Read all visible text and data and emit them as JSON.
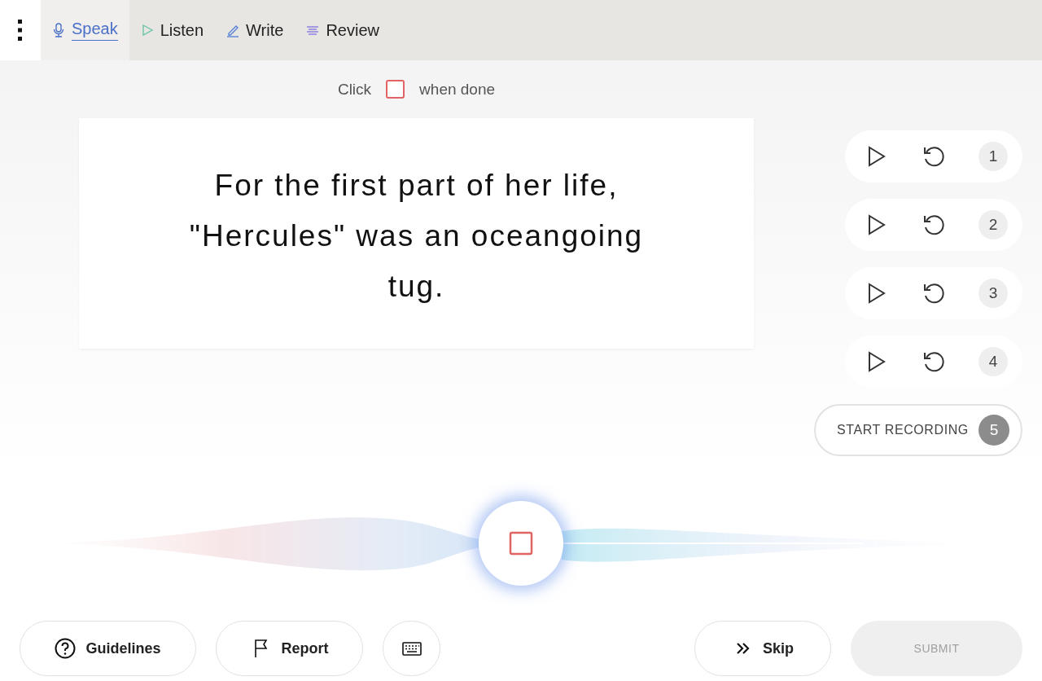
{
  "tabs": [
    {
      "kind": "speak",
      "label": "Speak",
      "selected": true
    },
    {
      "kind": "listen",
      "label": "Listen",
      "selected": false
    },
    {
      "kind": "write",
      "label": "Write",
      "selected": false
    },
    {
      "kind": "review",
      "label": "Review",
      "selected": false
    }
  ],
  "done_hint": {
    "before": "Click",
    "after": "when done",
    "checked": false
  },
  "sentence": "For the first part of her life, \"Hercules\" was an oceangoing tug.",
  "clips": [
    {
      "number": "1"
    },
    {
      "number": "2"
    },
    {
      "number": "3"
    },
    {
      "number": "4"
    }
  ],
  "record_button": {
    "label": "START RECORDING",
    "number": "5"
  },
  "recording": true,
  "footer": {
    "guidelines": "Guidelines",
    "report": "Report",
    "skip": "Skip",
    "submit": {
      "label": "SUBMIT",
      "disabled": true
    }
  }
}
